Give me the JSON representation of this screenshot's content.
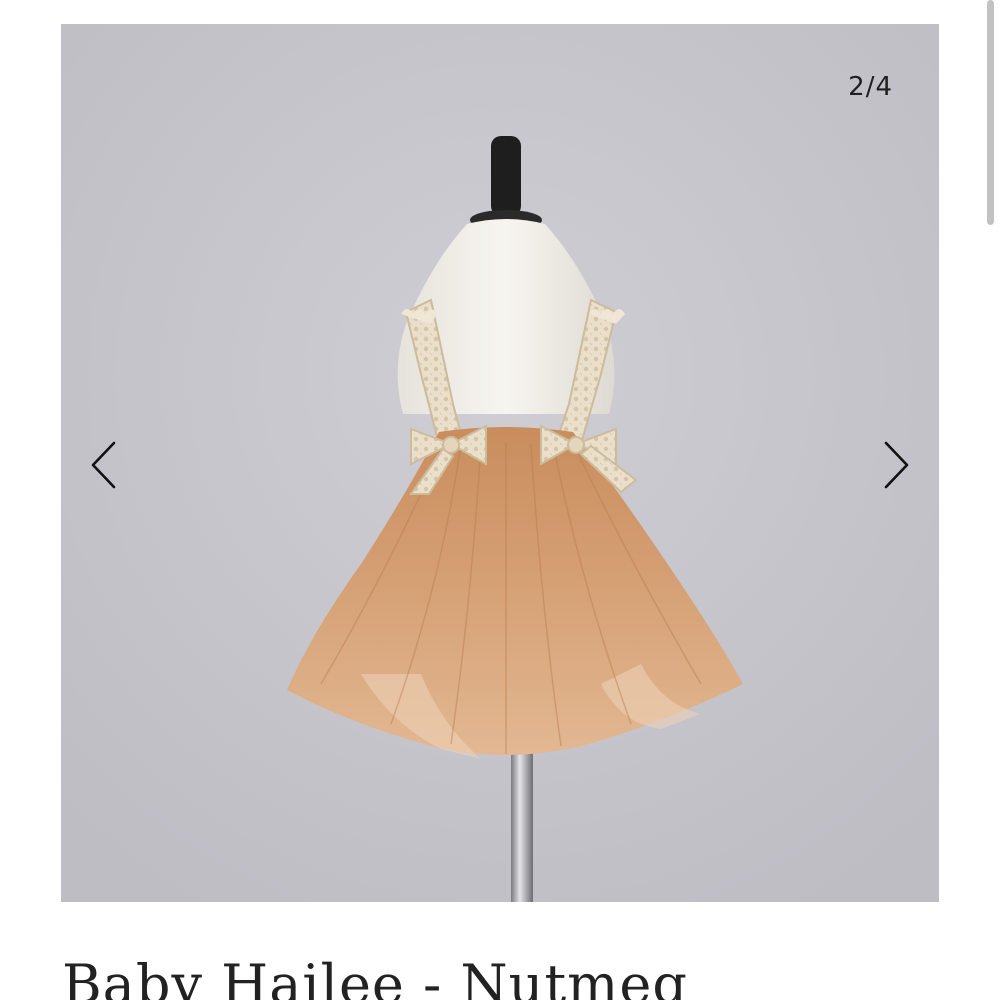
{
  "gallery": {
    "counter": "2/4",
    "current_index": 2,
    "total": 4,
    "prev_icon": "chevron-left-icon",
    "next_icon": "chevron-right-icon",
    "photo": "product-photo-tulle-dress-on-mannequin"
  },
  "product": {
    "title": "Baby Hailee - Nutmeg"
  },
  "colors": {
    "background": "#ffffff",
    "photo_backdrop": "#c6c5cb",
    "tulle": "#d6a176",
    "lace": "#e8dcc8",
    "text": "#222222"
  }
}
